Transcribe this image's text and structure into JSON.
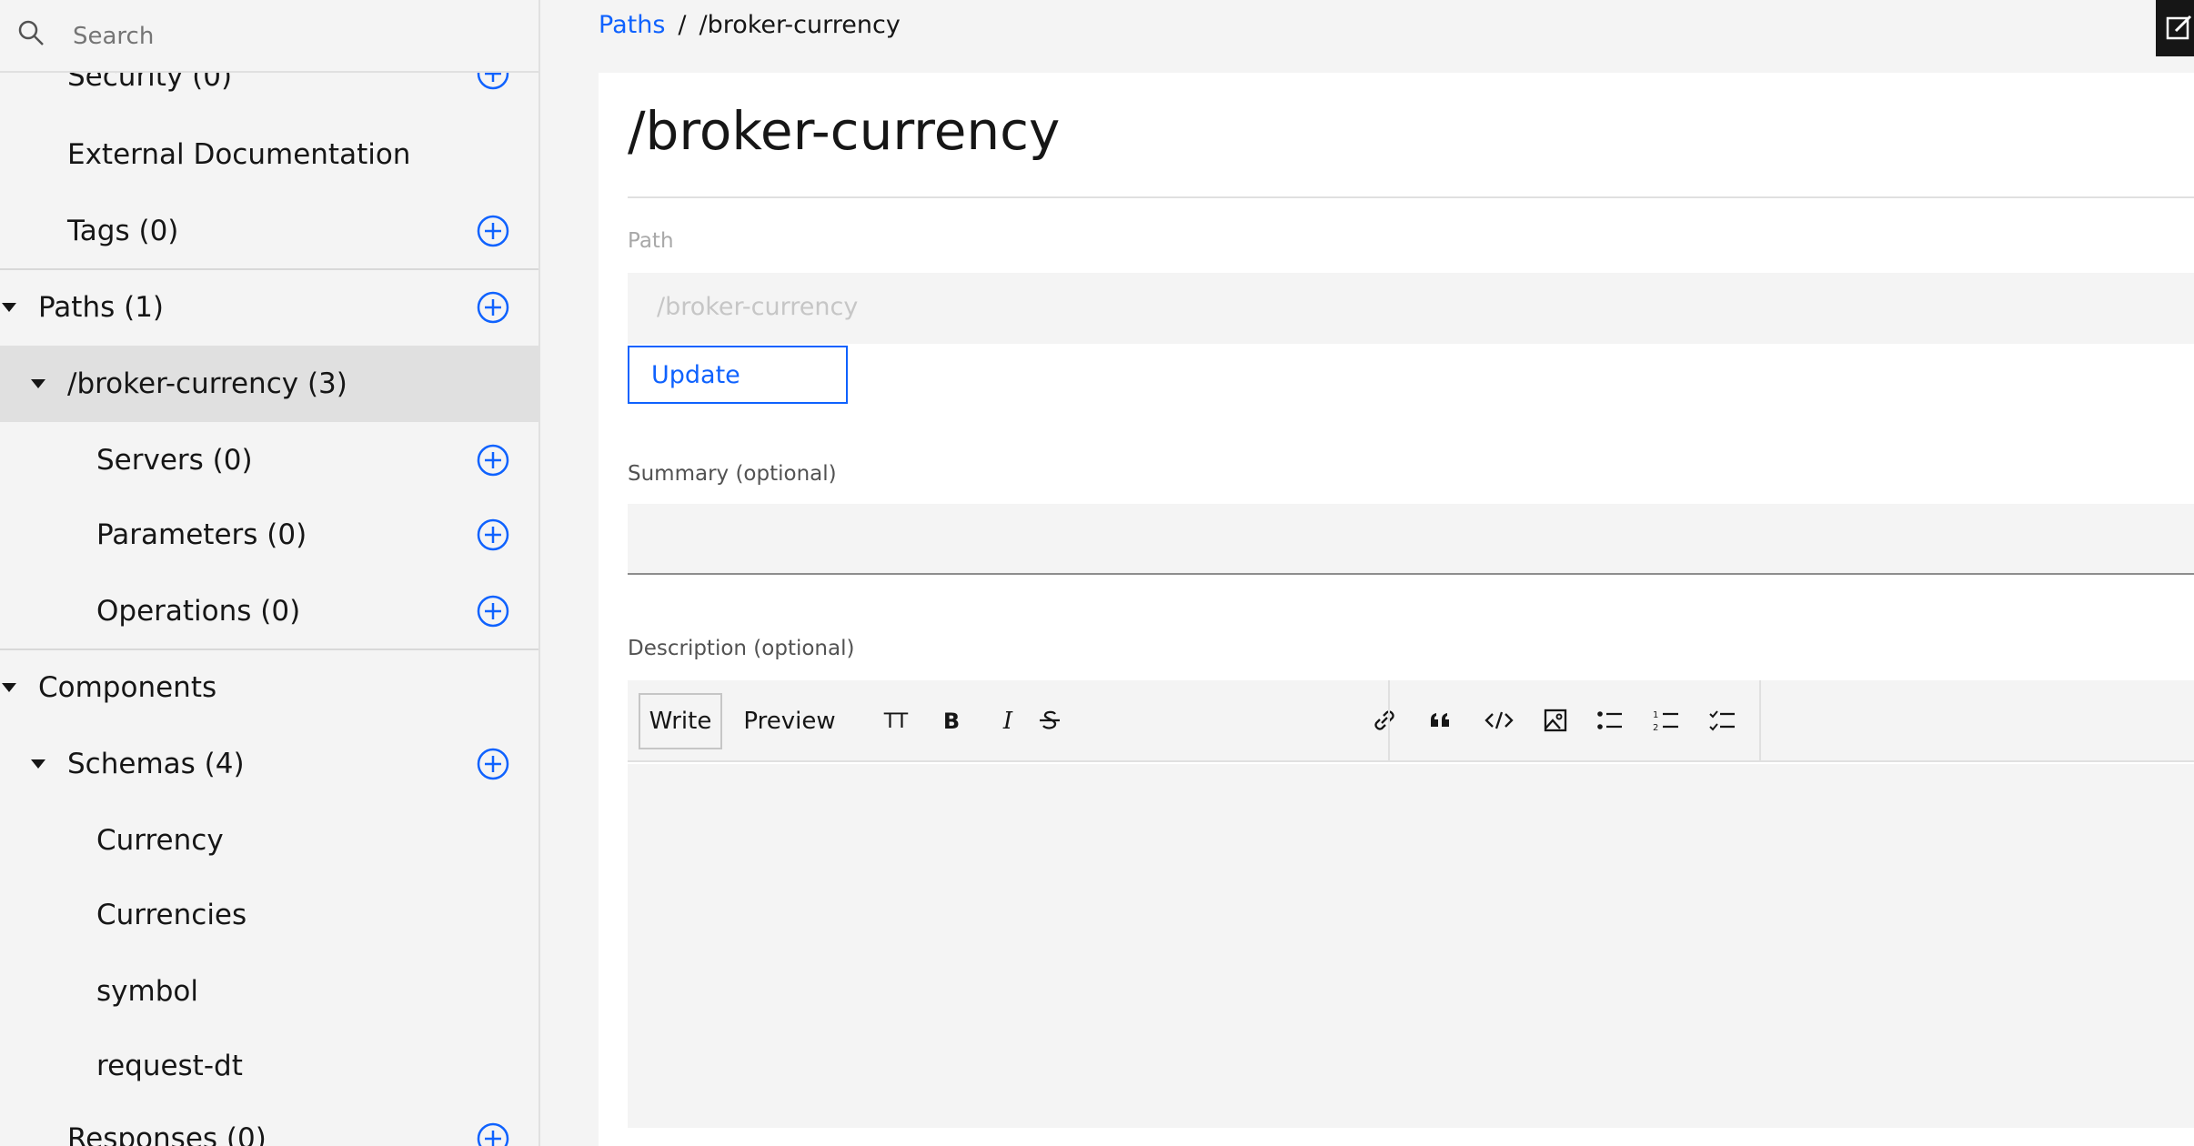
{
  "search": {
    "placeholder": "Search"
  },
  "sidebar": {
    "items": [
      {
        "label": "Security (0)"
      },
      {
        "label": "External Documentation"
      },
      {
        "label": "Tags (0)"
      },
      {
        "label": "Paths (1)"
      },
      {
        "label": "/broker-currency (3)"
      },
      {
        "label": "Servers (0)"
      },
      {
        "label": "Parameters (0)"
      },
      {
        "label": "Operations (0)"
      },
      {
        "label": "Components"
      },
      {
        "label": "Schemas (4)"
      },
      {
        "label": "Currency"
      },
      {
        "label": "Currencies"
      },
      {
        "label": "symbol"
      },
      {
        "label": "request-dt"
      },
      {
        "label": "Responses (0)"
      }
    ]
  },
  "breadcrumb": {
    "parent": "Paths",
    "separator": "/",
    "current": "/broker-currency"
  },
  "main": {
    "title": "/broker-currency",
    "path_label": "Path",
    "path_value": "/broker-currency",
    "update_label": "Update",
    "summary_label": "Summary (optional)",
    "summary_value": "",
    "description_label": "Description (optional)",
    "description_value": "",
    "toolbar": {
      "write_label": "Write",
      "preview_label": "Preview",
      "heading_label": "TT",
      "bold_label": "B",
      "italic_label": "I"
    }
  },
  "colors": {
    "accent": "#0f62fe",
    "text": "#161616",
    "sidebar_bg": "#f4f4f4",
    "selected_bg": "#e0e0e0"
  }
}
